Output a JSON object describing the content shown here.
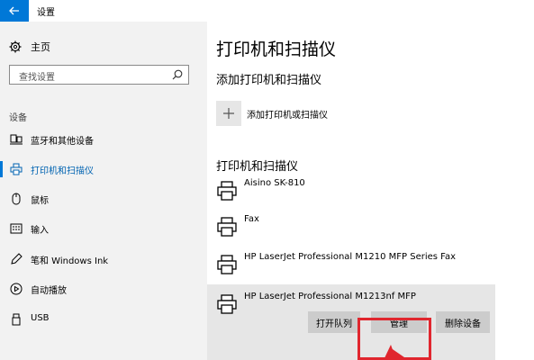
{
  "window": {
    "title": "设置"
  },
  "colors": {
    "accent": "#0078d7",
    "annotation": "#e0262e"
  },
  "sidebar": {
    "home_label": "主页",
    "search_placeholder": "查找设置",
    "section_label": "设备",
    "items": [
      {
        "label": "蓝牙和其他设备",
        "icon": "bluetooth-devices-icon",
        "active": false
      },
      {
        "label": "打印机和扫描仪",
        "icon": "printer-icon",
        "active": true
      },
      {
        "label": "鼠标",
        "icon": "mouse-icon",
        "active": false
      },
      {
        "label": "输入",
        "icon": "keyboard-icon",
        "active": false
      },
      {
        "label": "笔和 Windows Ink",
        "icon": "pen-icon",
        "active": false
      },
      {
        "label": "自动播放",
        "icon": "autoplay-icon",
        "active": false
      },
      {
        "label": "USB",
        "icon": "usb-icon",
        "active": false
      }
    ]
  },
  "main": {
    "title": "打印机和扫描仪",
    "add_section_title": "添加打印机和扫描仪",
    "add_button_label": "添加打印机或扫描仪",
    "list_title": "打印机和扫描仪",
    "printers": [
      {
        "name": "Aisino SK-810",
        "selected": false
      },
      {
        "name": "Fax",
        "selected": false
      },
      {
        "name": "HP LaserJet Professional M1210 MFP Series Fax",
        "selected": false
      },
      {
        "name": "HP LaserJet Professional M1213nf MFP",
        "selected": true
      }
    ],
    "actions": {
      "open_queue": "打开队列",
      "manage": "管理",
      "remove_device": "删除设备"
    }
  }
}
